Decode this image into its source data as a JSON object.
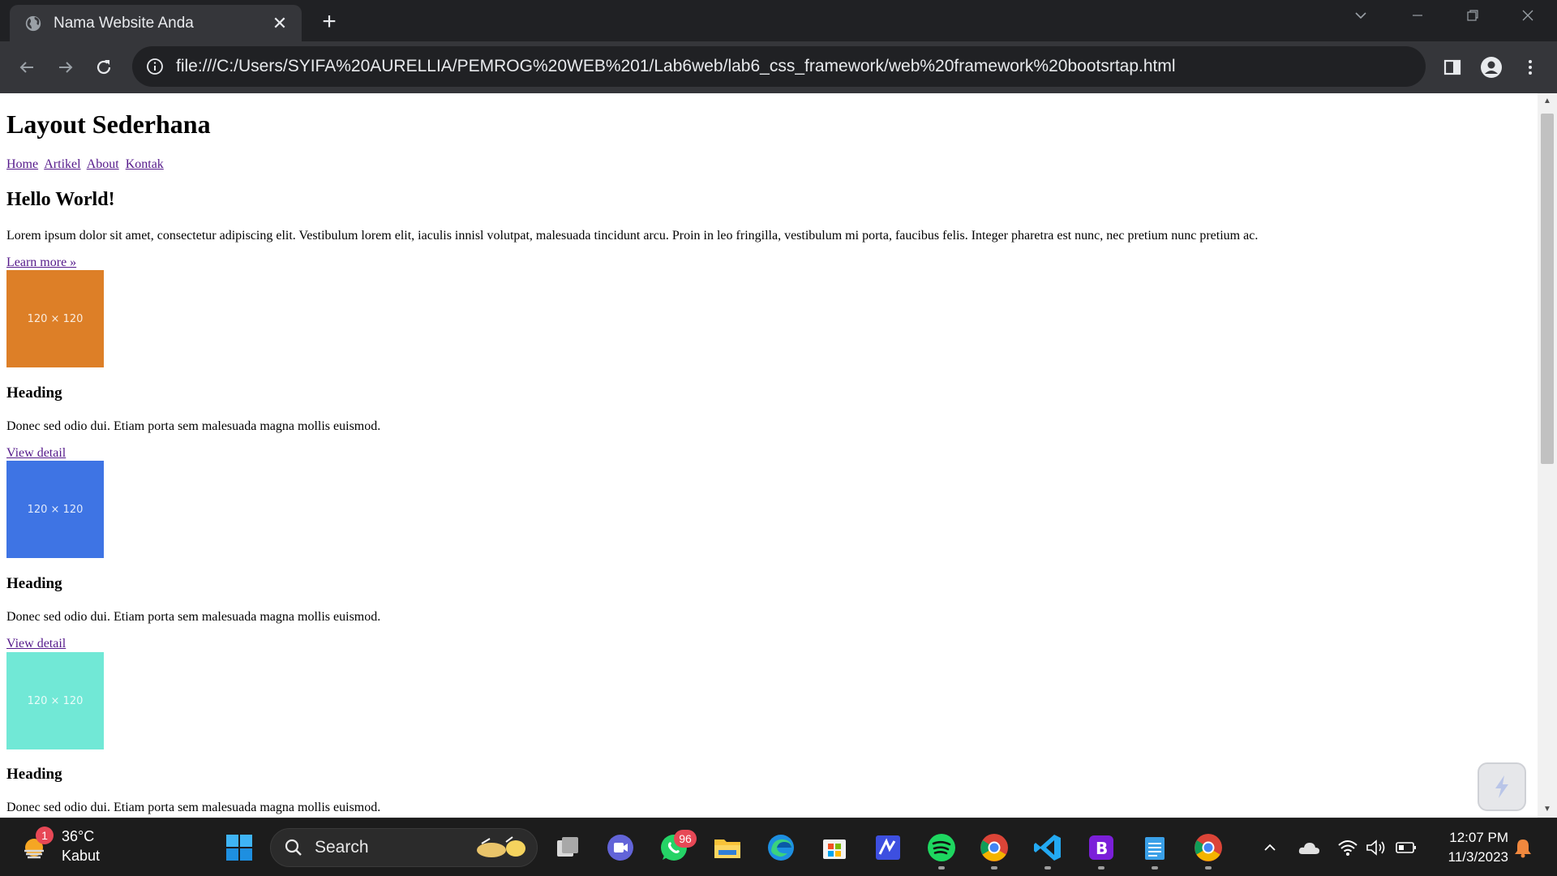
{
  "browser": {
    "tab_title": "Nama Website Anda",
    "close_glyph": "✕",
    "new_tab_glyph": "+",
    "url": "file:///C:/Users/SYIFA%20AURELLIA/PEMROG%20WEB%201/Lab6web/lab6_css_framework/web%20framework%20bootsrtap.html"
  },
  "page": {
    "heading": "Layout Sederhana",
    "nav": [
      "Home",
      "Artikel",
      "About",
      "Kontak"
    ],
    "hero_title": "Hello World!",
    "hero_text": "Lorem ipsum dolor sit amet, consectetur adipiscing elit. Vestibulum lorem elit, iaculis innisl volutpat, malesuada tincidunt arcu. Proin in leo fringilla, vestibulum mi porta, faucibus felis. Integer pharetra est nunc, nec pretium nunc pretium ac.",
    "learn_more": "Learn more »",
    "cards": [
      {
        "image_label": "120 × 120",
        "image_color": "#dd7f27",
        "heading": "Heading",
        "text": "Donec sed odio dui. Etiam porta sem malesuada magna mollis euismod.",
        "link": "View detail"
      },
      {
        "image_label": "120 × 120",
        "image_color": "#3e74e4",
        "heading": "Heading",
        "text": "Donec sed odio dui. Etiam porta sem malesuada magna mollis euismod.",
        "link": "View detail"
      },
      {
        "image_label": "120 × 120",
        "image_color": "#71e8d6",
        "heading": "Heading",
        "text": "Donec sed odio dui. Etiam porta sem malesuada magna mollis euismod."
      }
    ]
  },
  "taskbar": {
    "weather_temp": "36°C",
    "weather_desc": "Kabut",
    "weather_badge": "1",
    "search_label": "Search",
    "whatsapp_badge": "96",
    "time": "12:07 PM",
    "date": "11/3/2023"
  },
  "colors": {
    "chrome_dark": "#202124",
    "chrome_toolbar": "#35363a",
    "link_visited": "#551a8b",
    "taskbar_bg": "#1c1c1c",
    "badge_red": "#e74856"
  }
}
